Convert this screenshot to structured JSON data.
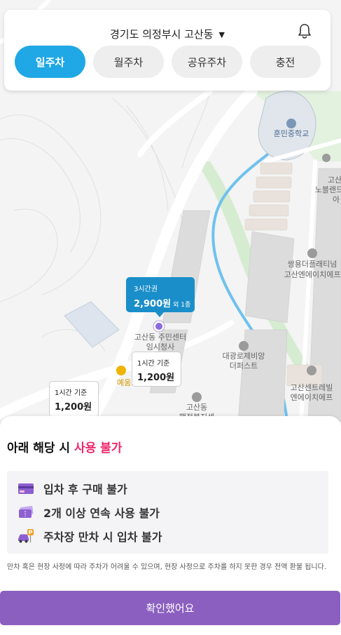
{
  "header": {
    "location": "경기도 의정부시 고산동",
    "tabs": [
      {
        "label": "일주차",
        "active": true
      },
      {
        "label": "월주차",
        "active": false
      },
      {
        "label": "공유주차",
        "active": false
      },
      {
        "label": "충전",
        "active": false
      }
    ]
  },
  "map": {
    "labels": {
      "school": "훈민중학교",
      "apt_right_1": "고산",
      "apt_right_2": "노블랜드",
      "apt_right_3": "아",
      "ssangyong_1": "쌍용더플래티넘",
      "ssangyong_2": "고산엔에이치에프",
      "center_1": "고산동 주민센터",
      "center_2": "임시청사",
      "daegwang_1": "대광로제비앙",
      "daegwang_2": "더퍼스트",
      "centrereval_1": "고산센트레빌",
      "centrereval_2": "엔에이치에프",
      "yeum": "예움프리",
      "gosan_bottom_1": "고산동",
      "gosan_bottom_2": "행정복지센"
    },
    "markers": {
      "primary": {
        "title": "3시간권",
        "price": "2,900원",
        "extra": "외 1종"
      },
      "middle": {
        "title": "1시간 기준",
        "price": "1,200원"
      },
      "left": {
        "title": "1시간 기준",
        "price": "1,200원"
      }
    },
    "colors": {
      "primary_marker": "#1a8ec9",
      "stream": "#6fc1ee",
      "park": "#d5ecd0"
    }
  },
  "sheet": {
    "title_prefix": "아래 해당 시 ",
    "title_highlight": "사용 불가",
    "rules": [
      {
        "icon": "credit-card-icon",
        "text": "입차 후 구매 불가"
      },
      {
        "icon": "tickets-icon",
        "text": "2개 이상 연속 사용 불가"
      },
      {
        "icon": "car-parking-icon",
        "text": "주차장 만차 시 입차 불가"
      }
    ],
    "notice": "만차 혹은 현장 사정에 따라 주차가 어려울 수 있으며, 현장 사정으로 주차를 하지 못한 경우 전액 환불 됩니다.",
    "confirm_label": "확인했어요"
  }
}
